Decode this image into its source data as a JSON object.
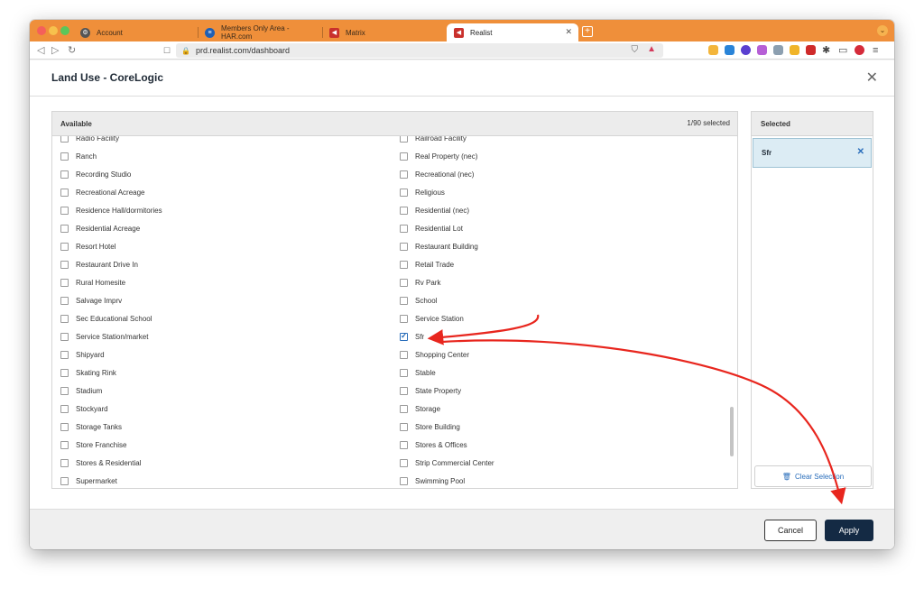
{
  "browser": {
    "tabs": [
      {
        "label": "Account",
        "active": false
      },
      {
        "label": "Members Only Area - HAR.com",
        "active": false
      },
      {
        "label": "Matrix",
        "active": false
      },
      {
        "label": "Realist",
        "active": true
      }
    ],
    "url": "prd.realist.com/dashboard",
    "accent_color": "#ef8f3a"
  },
  "modal": {
    "title": "Land Use - CoreLogic",
    "available_label": "Available",
    "selected_count": "1/90 selected",
    "selected_label": "Selected",
    "left_items": [
      {
        "label": "Radio Facility",
        "checked": false
      },
      {
        "label": "Ranch",
        "checked": false
      },
      {
        "label": "Recording Studio",
        "checked": false
      },
      {
        "label": "Recreational Acreage",
        "checked": false
      },
      {
        "label": "Residence Hall/dormitories",
        "checked": false
      },
      {
        "label": "Residential Acreage",
        "checked": false
      },
      {
        "label": "Resort Hotel",
        "checked": false
      },
      {
        "label": "Restaurant Drive In",
        "checked": false
      },
      {
        "label": "Rural Homesite",
        "checked": false
      },
      {
        "label": "Salvage Imprv",
        "checked": false
      },
      {
        "label": "Sec Educational School",
        "checked": false
      },
      {
        "label": "Service Station/market",
        "checked": false
      },
      {
        "label": "Shipyard",
        "checked": false
      },
      {
        "label": "Skating Rink",
        "checked": false
      },
      {
        "label": "Stadium",
        "checked": false
      },
      {
        "label": "Stockyard",
        "checked": false
      },
      {
        "label": "Storage Tanks",
        "checked": false
      },
      {
        "label": "Store Franchise",
        "checked": false
      },
      {
        "label": "Stores & Residential",
        "checked": false
      },
      {
        "label": "Supermarket",
        "checked": false
      }
    ],
    "right_items": [
      {
        "label": "Railroad Facility",
        "checked": false
      },
      {
        "label": "Real Property (nec)",
        "checked": false
      },
      {
        "label": "Recreational (nec)",
        "checked": false
      },
      {
        "label": "Religious",
        "checked": false
      },
      {
        "label": "Residential (nec)",
        "checked": false
      },
      {
        "label": "Residential Lot",
        "checked": false
      },
      {
        "label": "Restaurant Building",
        "checked": false
      },
      {
        "label": "Retail Trade",
        "checked": false
      },
      {
        "label": "Rv Park",
        "checked": false
      },
      {
        "label": "School",
        "checked": false
      },
      {
        "label": "Service Station",
        "checked": false
      },
      {
        "label": "Sfr",
        "checked": true
      },
      {
        "label": "Shopping Center",
        "checked": false
      },
      {
        "label": "Stable",
        "checked": false
      },
      {
        "label": "State Property",
        "checked": false
      },
      {
        "label": "Storage",
        "checked": false
      },
      {
        "label": "Store Building",
        "checked": false
      },
      {
        "label": "Stores & Offices",
        "checked": false
      },
      {
        "label": "Strip Commercial Center",
        "checked": false
      },
      {
        "label": "Swimming Pool",
        "checked": false
      }
    ],
    "selected_items": [
      "Sfr"
    ],
    "clear_selection_label": "Clear Selection",
    "cancel_label": "Cancel",
    "apply_label": "Apply"
  },
  "annotation_color": "#e8261e"
}
